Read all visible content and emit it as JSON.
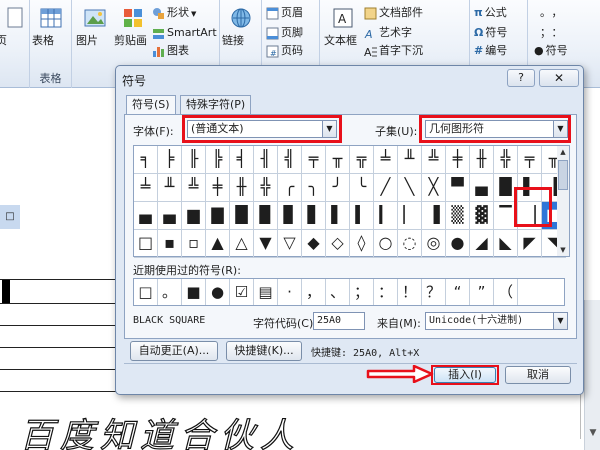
{
  "ribbon": {
    "page_label": "页",
    "table_label": "表格",
    "picture_label": "图片",
    "clipart_label": "剪贴画",
    "shapes_label": "形状",
    "smartart_label": "SmartArt",
    "chart_label": "图表",
    "tables_group_label": "表格",
    "link_label": "链接",
    "header_label": "页眉",
    "footer_label": "页脚",
    "pagenum_label": "页码",
    "textbox_label": "文本框",
    "quickparts_label": "文档部件",
    "wordart_label": "艺术字",
    "dropcap_label": "首字下沉",
    "equation_label": "公式",
    "symbol_label": "符号",
    "number_label": "编号",
    "sym_label": "符号",
    "sym_glyph_top": "。，",
    "sym_glyph_mid": "；：",
    "icon_equation": "π",
    "icon_symbol": "Ω",
    "icon_number": "#"
  },
  "dialog": {
    "title": "符号",
    "help": "?",
    "close": "✕",
    "tabs": [
      "符号(S)",
      "特殊字符(P)"
    ],
    "font_label": "字体(F):",
    "font_value": "(普通文本)",
    "subset_label": "子集(U):",
    "subset_value": "几何图形符",
    "symbols": [
      [
        "╕",
        "╞",
        "╟",
        "╠",
        "╡",
        "╢",
        "╣",
        "╤",
        "╥",
        "╦",
        "╧",
        "╨",
        "╩",
        "╪",
        "╫",
        "╬",
        "╤",
        "╥"
      ],
      [
        "╧",
        "╨",
        "╩",
        "╪",
        "╫",
        "╬",
        "╭",
        "╮",
        "╯",
        "╰",
        "╱",
        "╲",
        "╳",
        "▀",
        "▄",
        "█",
        "▌",
        "▐"
      ],
      [
        "▄",
        "▄",
        "▆",
        "▇",
        "█",
        "▉",
        "▊",
        "▋",
        "▌",
        "▍",
        "▎",
        "▏",
        "▐",
        "▒",
        "▓",
        "▔",
        "▕",
        "■"
      ],
      [
        "□",
        "▪",
        "▫",
        "▲",
        "△",
        "▼",
        "▽",
        "◆",
        "◇",
        "◊",
        "○",
        "◌",
        "◎",
        "●",
        "◢",
        "◣",
        "◤",
        "◥"
      ]
    ],
    "recent_label": "近期使用过的符号(R):",
    "recent": [
      "□",
      "。",
      "■",
      "●",
      "☑",
      "▤",
      "·",
      "，",
      "、",
      "；",
      "：",
      "！",
      "？",
      "“",
      "”",
      "（"
    ],
    "char_name": "BLACK SQUARE",
    "charcode_label": "字符代码(C):",
    "charcode_value": "25A0",
    "from_label": "来自(M):",
    "from_value": "Unicode(十六进制)",
    "autocorrect_label": "自动更正(A)...",
    "shortcut_key_label": "快捷键(K)...",
    "shortcut_info": "快捷键: 25A0, Alt+X",
    "insert_label": "插入(I)",
    "cancel_label": "取消"
  },
  "document": {
    "square_mark": "□",
    "watermark": "百度知道合伙人"
  },
  "colors": {
    "highlight": "#e8101a",
    "selection": "#2f76d8"
  }
}
